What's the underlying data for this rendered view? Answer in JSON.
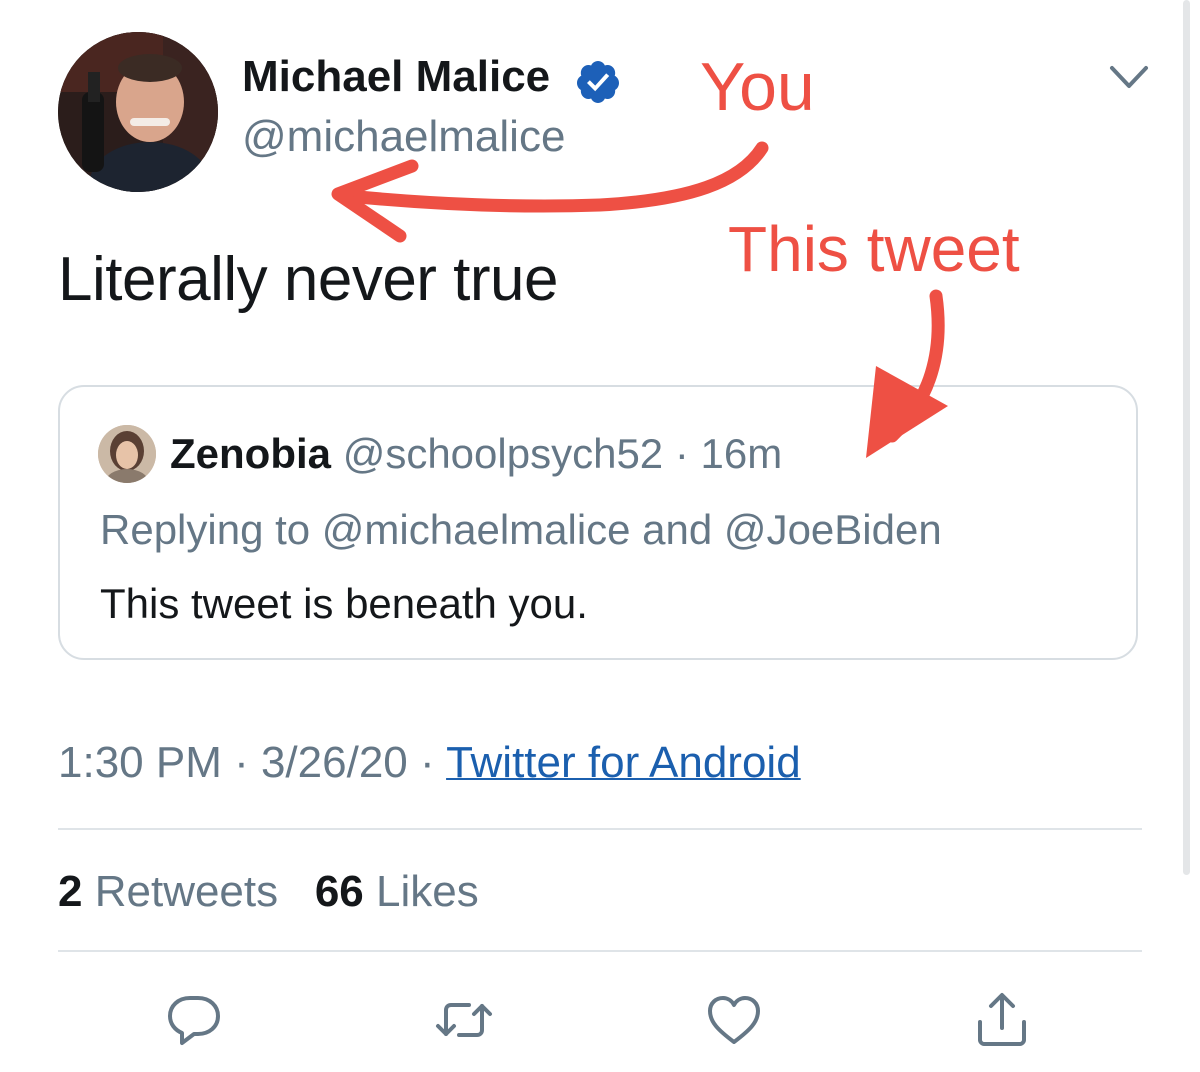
{
  "tweet": {
    "display_name": "Michael Malice",
    "handle": "@michaelmalice",
    "text": "Literally never true",
    "timestamp": "1:30 PM · 3/26/20 · ",
    "source": "Twitter for Android"
  },
  "quote": {
    "name": "Zenobia",
    "handle": "@schoolpsych52",
    "separator": " · ",
    "time": "16m",
    "reply_label": "Replying to @michaelmalice and @JoeBiden",
    "text": "This tweet is beneath you."
  },
  "stats": {
    "retweets_count": "2",
    "retweets_label": "Retweets",
    "likes_count": "66",
    "likes_label": "Likes"
  },
  "annotations": {
    "you": "You",
    "this_tweet": "This tweet"
  },
  "icons": {
    "verified": "verified-badge-icon",
    "menu": "chevron-down-icon",
    "reply": "reply-bubble-icon",
    "retweet": "retweet-icon",
    "like": "heart-icon",
    "share": "share-upload-icon"
  },
  "colors": {
    "annotation": "#ee5044",
    "link": "#1b5fae",
    "verified": "#1d60b8",
    "muted": "#657786"
  }
}
